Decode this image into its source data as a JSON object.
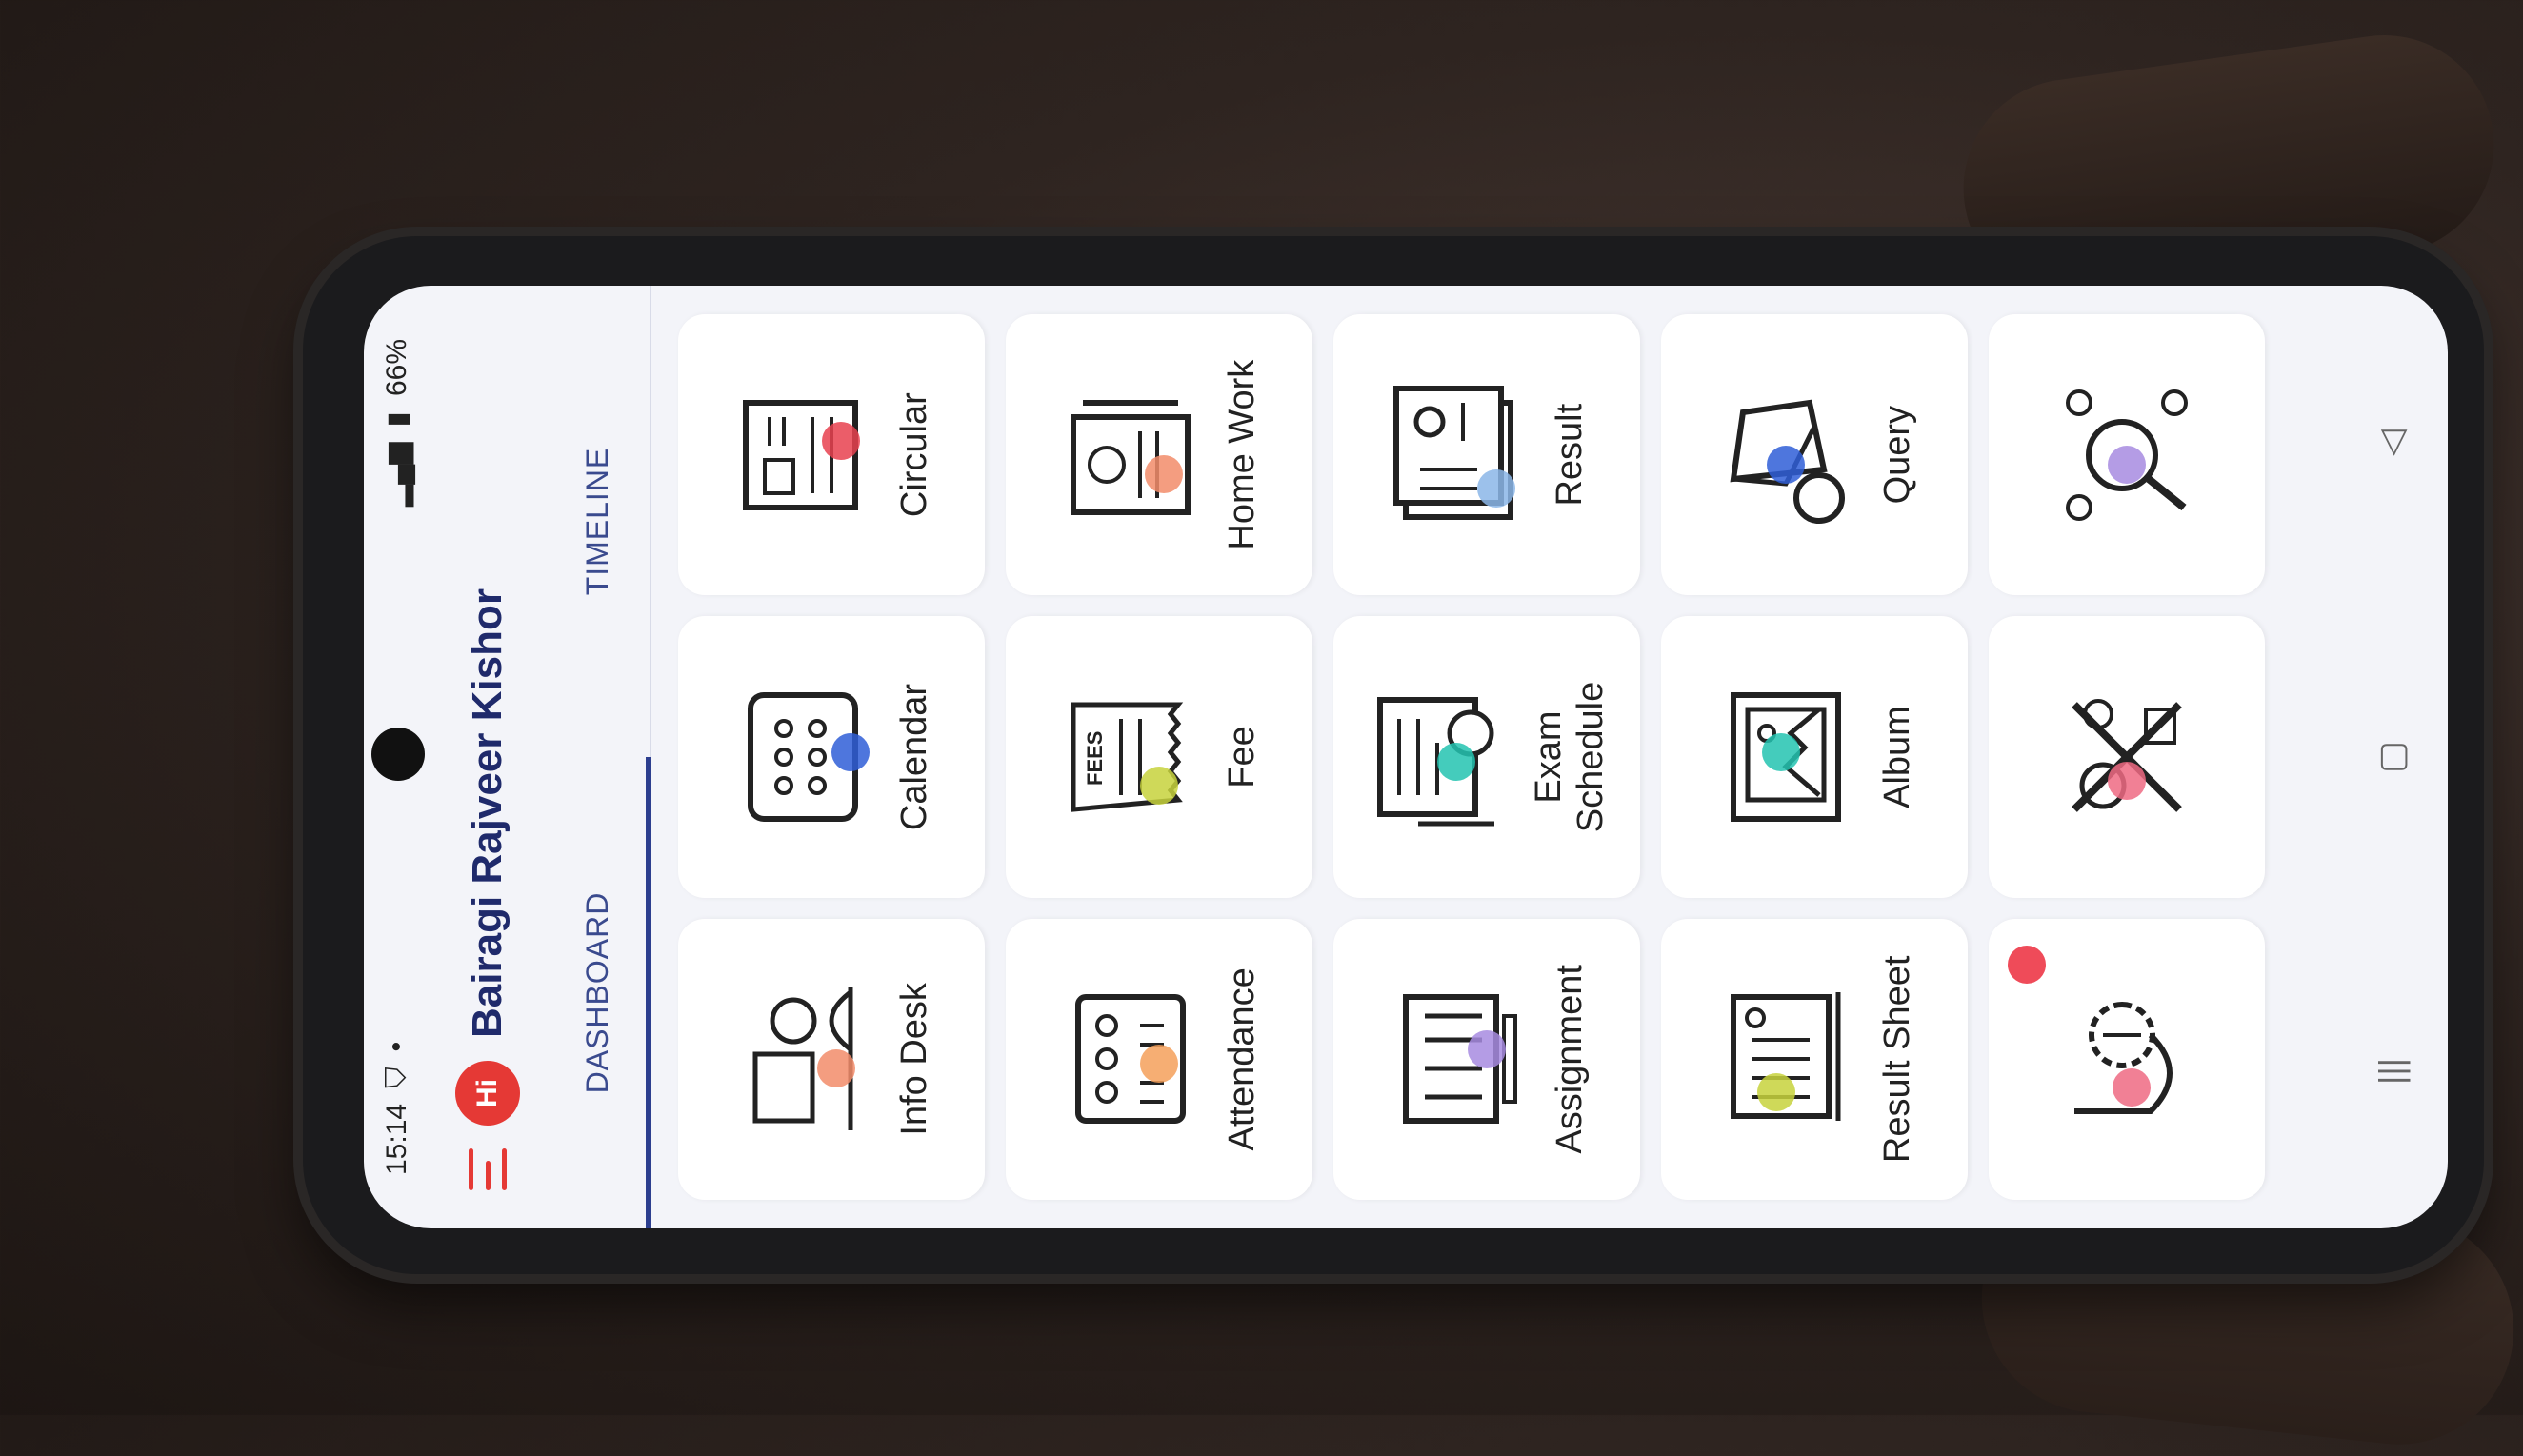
{
  "status": {
    "time": "15:14",
    "battery": "66%"
  },
  "header": {
    "greeting": "Hi",
    "user_name": "Bairagi Rajveer Kishor"
  },
  "tabs": [
    {
      "label": "DASHBOARD",
      "active": true
    },
    {
      "label": "TIMELINE",
      "active": false
    }
  ],
  "tiles": [
    {
      "label": "Info Desk",
      "icon": "info-desk-icon",
      "accent": "#f28c6a"
    },
    {
      "label": "Calendar",
      "icon": "calendar-icon",
      "accent": "#2f5ed7"
    },
    {
      "label": "Circular",
      "icon": "circular-icon",
      "accent": "#e8414f"
    },
    {
      "label": "Attendance",
      "icon": "attendance-icon",
      "accent": "#f5a05b"
    },
    {
      "label": "Fee",
      "icon": "fees-icon",
      "accent": "#c7d23c"
    },
    {
      "label": "Home Work",
      "icon": "homework-icon",
      "accent": "#f28c6a"
    },
    {
      "label": "Assignment",
      "icon": "assignment-icon",
      "accent": "#a78be0"
    },
    {
      "label": "Exam\nSchedule",
      "icon": "exam-schedule-icon",
      "accent": "#23c3b0"
    },
    {
      "label": "Result",
      "icon": "result-icon",
      "accent": "#8bb6e8"
    },
    {
      "label": "Result Sheet",
      "icon": "result-sheet-icon",
      "accent": "#c7d23c"
    },
    {
      "label": "Album",
      "icon": "album-icon",
      "accent": "#23c3b0"
    },
    {
      "label": "Query",
      "icon": "query-icon",
      "accent": "#2f5ed7"
    },
    {
      "label": "",
      "icon": "teacher-profile-icon",
      "accent": "#ef6a82"
    },
    {
      "label": "",
      "icon": "activities-icon",
      "accent": "#ef6a82"
    },
    {
      "label": "",
      "icon": "network-search-icon",
      "accent": "#a78be0"
    }
  ],
  "nav": [
    {
      "icon": "recent-apps-icon"
    },
    {
      "icon": "home-icon"
    },
    {
      "icon": "back-icon"
    }
  ]
}
